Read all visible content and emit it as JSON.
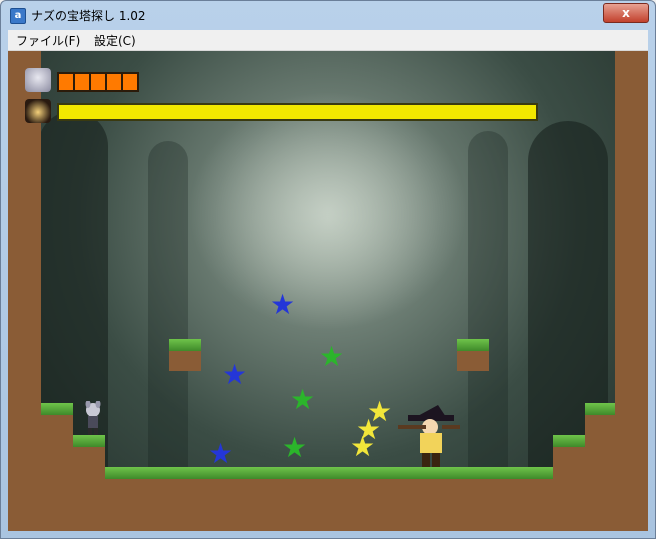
{
  "window": {
    "title": "ナズの宝塔探し 1.02",
    "close_label": "x"
  },
  "menu": {
    "items": [
      {
        "label": "ファイル(F)"
      },
      {
        "label": "設定(C)"
      }
    ]
  },
  "hud": {
    "player_life_cells": 5,
    "boss_health_fraction": 1.0,
    "life_color": "#ff7a00",
    "boss_bar_color": "#f2e800"
  },
  "colors": {
    "dirt": "#8a5c36",
    "grass": "#5aa83a",
    "blue_star": "#2436d8",
    "green_star": "#2bb52b",
    "yellow_star": "#f2e63a"
  }
}
